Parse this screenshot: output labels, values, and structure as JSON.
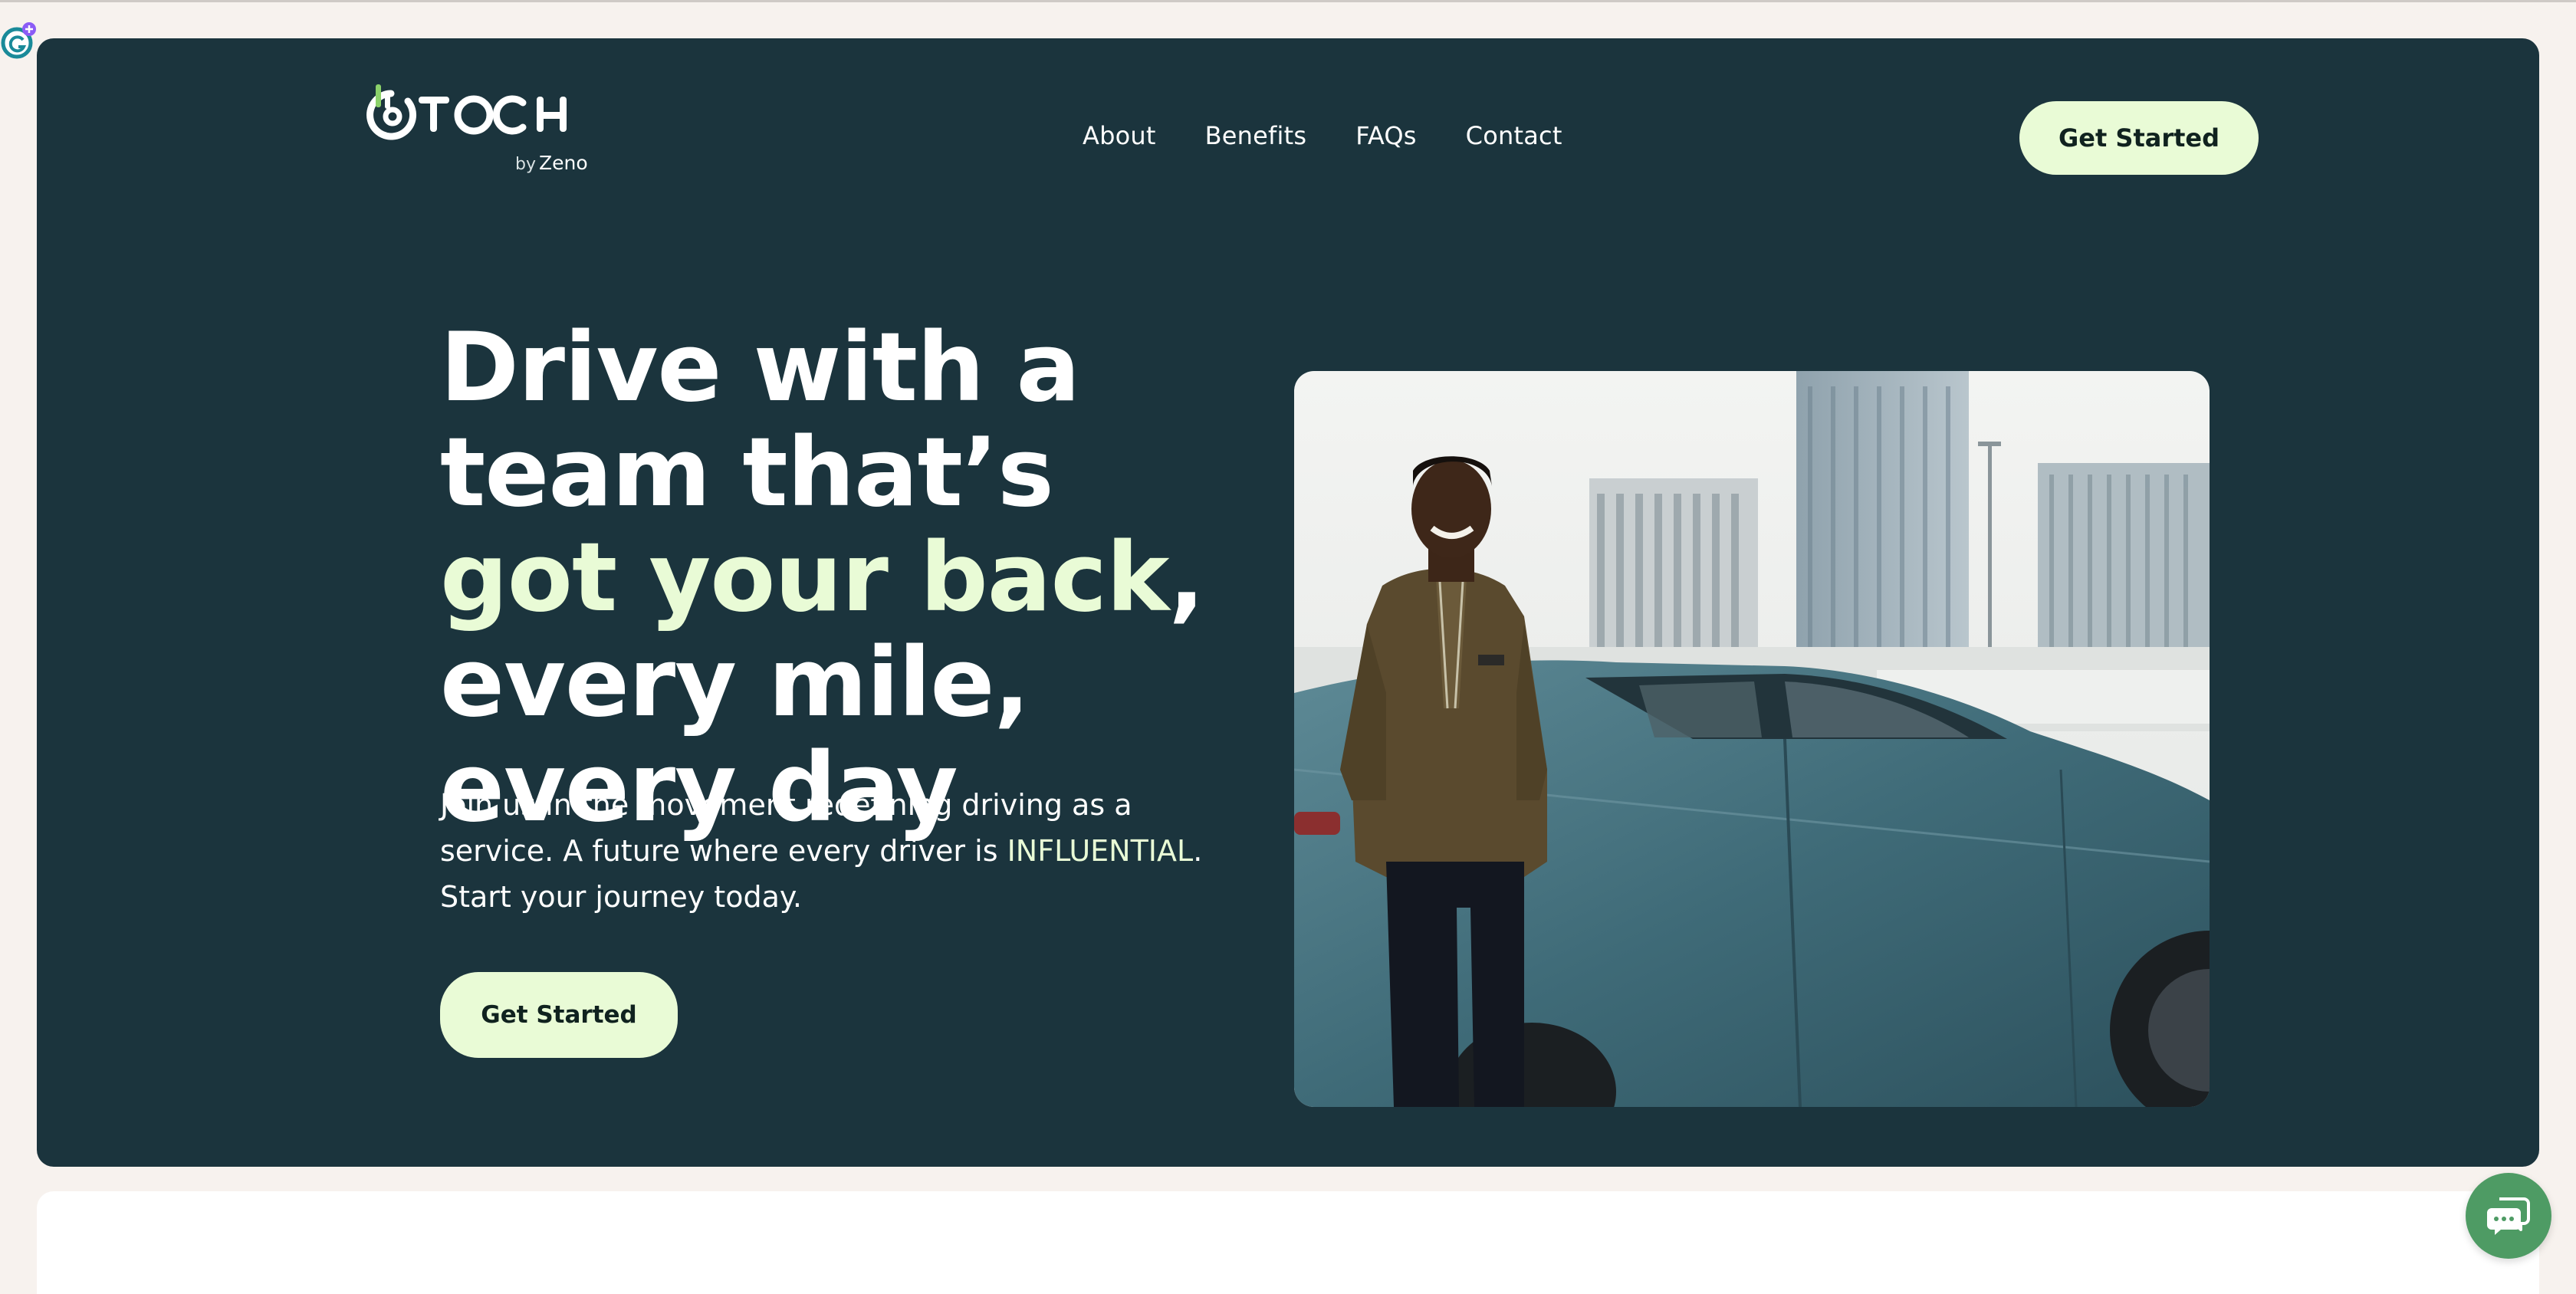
{
  "brand": {
    "logo_text": "TOCH",
    "by_label": "by",
    "parent_name": "Zeno"
  },
  "nav": {
    "items": [
      {
        "label": "About"
      },
      {
        "label": "Benefits"
      },
      {
        "label": "FAQs"
      },
      {
        "label": "Contact"
      }
    ],
    "cta_label": "Get Started"
  },
  "hero": {
    "headline_part1": "Drive with a team that’s ",
    "headline_highlight": "got your back",
    "headline_part2": ", every mile, every day",
    "subcopy_part1": "Join us in the movement redefining driving as a service. A future where every driver is ",
    "subcopy_highlight": "INFLUENTIAL",
    "subcopy_part2": ". Start your journey today.",
    "cta_label": "Get Started",
    "image_alt": "Smiling man leaning against a teal car with city buildings behind"
  },
  "colors": {
    "page_bg": "#f7f2ee",
    "hero_bg": "#1b343d",
    "accent": "#e9fbd6",
    "chat_green": "#4e9b64"
  },
  "icons": {
    "extension_badge": "grammarly-icon",
    "chat_launcher": "chat-bubble-icon"
  }
}
